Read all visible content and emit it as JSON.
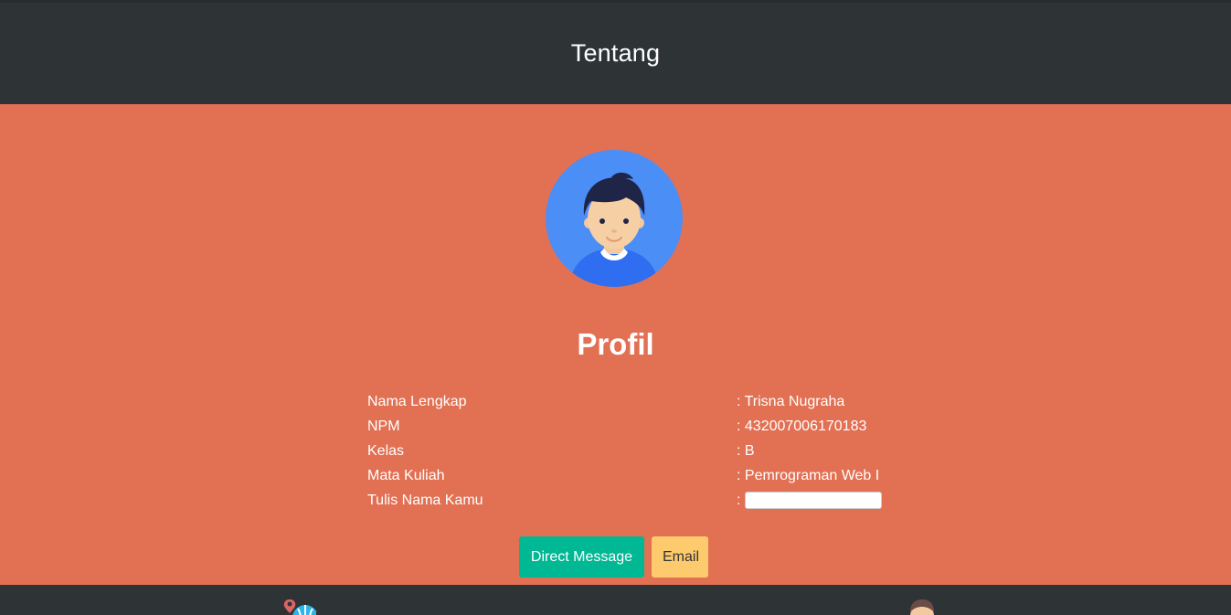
{
  "header": {
    "title": "Tentang"
  },
  "profile": {
    "title": "Profil",
    "rows": [
      {
        "label": "Nama Lengkap",
        "value": ": Trisna Nugraha"
      },
      {
        "label": "NPM",
        "value": ": 432007006170183"
      },
      {
        "label": "Kelas",
        "value": ": B"
      },
      {
        "label": "Mata Kuliah",
        "value": ": Pemrograman Web I"
      }
    ],
    "input_row": {
      "label": "Tulis Nama Kamu",
      "prefix": ":",
      "value": "",
      "placeholder": ""
    }
  },
  "buttons": {
    "direct_message": "Direct Message",
    "email": "Email"
  },
  "colors": {
    "header_bg": "#2e3436",
    "main_bg": "#e27053",
    "dm_button": "#00b894",
    "email_button": "#fdcb6e",
    "avatar_bg": "#4b8ef6"
  },
  "icons": {
    "avatar": "user-avatar-icon",
    "footer_left": "globe-pin-icon",
    "footer_right": "person-icon"
  }
}
